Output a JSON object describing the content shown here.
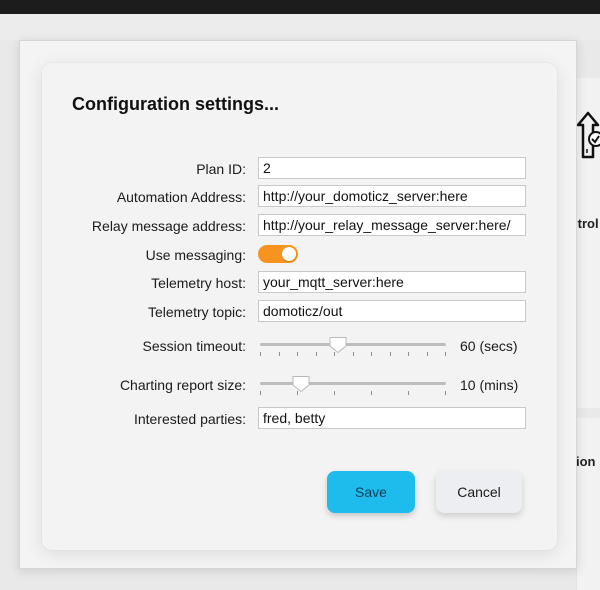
{
  "dialog": {
    "title": "Configuration settings..."
  },
  "background": {
    "partial_text_1": "itrol",
    "partial_text_2": "ion"
  },
  "fields": {
    "plan_id": {
      "label": "Plan ID:",
      "value": "2"
    },
    "automation_address": {
      "label": "Automation Address:",
      "value": "http://your_domoticz_server:here"
    },
    "relay_message_address": {
      "label": "Relay message address:",
      "value": "http://your_relay_message_server:here/"
    },
    "use_messaging": {
      "label": "Use messaging:",
      "enabled": true
    },
    "telemetry_host": {
      "label": "Telemetry host:",
      "value": "your_mqtt_server:here"
    },
    "telemetry_topic": {
      "label": "Telemetry topic:",
      "value": "domoticz/out"
    },
    "session_timeout": {
      "label": "Session timeout:",
      "value_text": "60 (secs)",
      "position": 0.42,
      "ticks": 11
    },
    "charting_report_size": {
      "label": "Charting report size:",
      "value_text": "10 (mins)",
      "position": 0.22,
      "ticks": 6
    },
    "interested_parties": {
      "label": "Interested parties:",
      "value": "fred, betty"
    }
  },
  "buttons": {
    "save": "Save",
    "cancel": "Cancel"
  },
  "colors": {
    "toggle_on": "#f7941f",
    "save_button": "#1ebcec"
  },
  "icons": {
    "background_upload": "upload-check-icon",
    "slider_thumb": "slider-thumb-icon"
  }
}
